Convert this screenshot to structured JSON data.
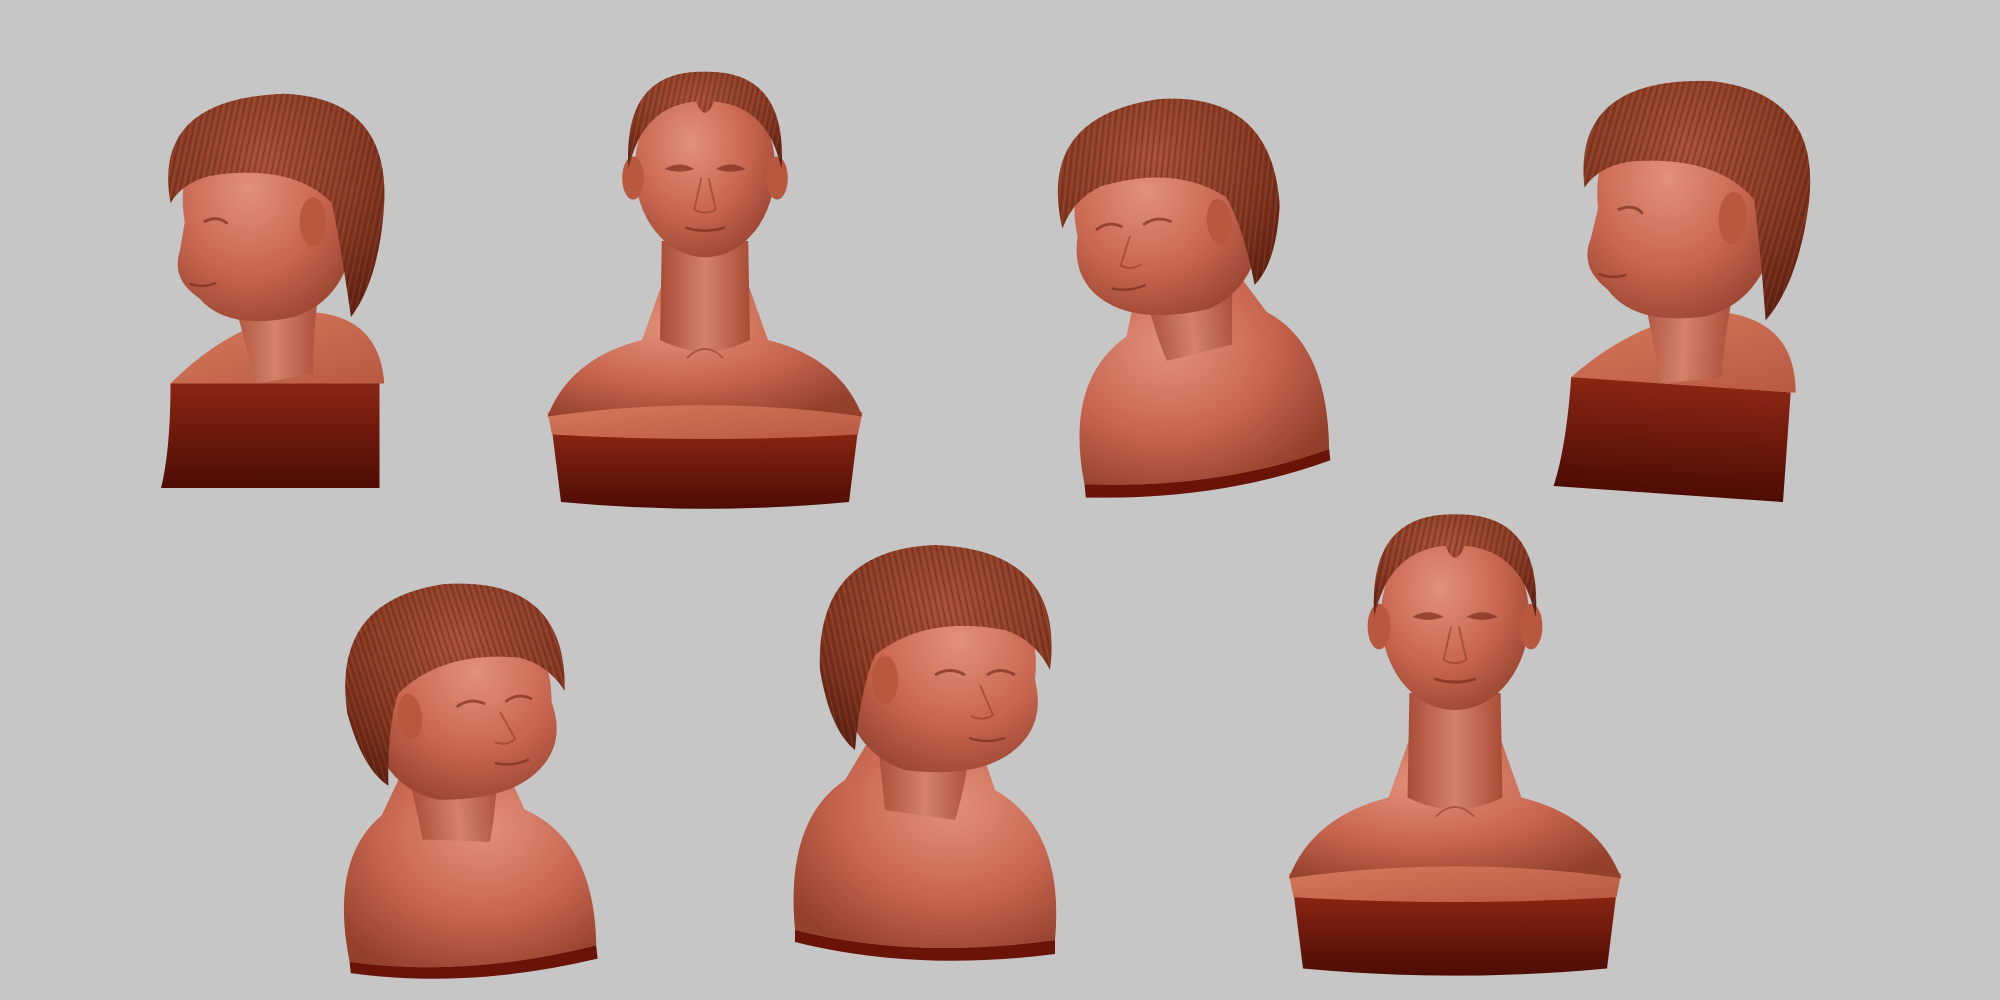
{
  "scene": {
    "background_color": "#c6c6c6",
    "subject": "sculpted-head-bust",
    "view_count": 7,
    "material": {
      "skin_light": "#d8806a",
      "skin_mid": "#c05e46",
      "skin_shadow": "#8e3a26",
      "hair": "#8a3c28",
      "hair_dark": "#5e2214",
      "hair_strand": "#b86048",
      "base_top": "#cc6a50",
      "base_side": "#6a1408"
    },
    "views": [
      {
        "view": "left-side-up",
        "row": 1,
        "col": 1
      },
      {
        "view": "front-up",
        "row": 1,
        "col": 2
      },
      {
        "view": "left-three-quarter-down",
        "row": 1,
        "col": 3
      },
      {
        "view": "left-three-quarter-up",
        "row": 1,
        "col": 4
      },
      {
        "view": "right-three-quarter-down",
        "row": 2,
        "col": 1
      },
      {
        "view": "right-three-quarter",
        "row": 2,
        "col": 2
      },
      {
        "view": "front",
        "row": 2,
        "col": 3
      }
    ]
  }
}
